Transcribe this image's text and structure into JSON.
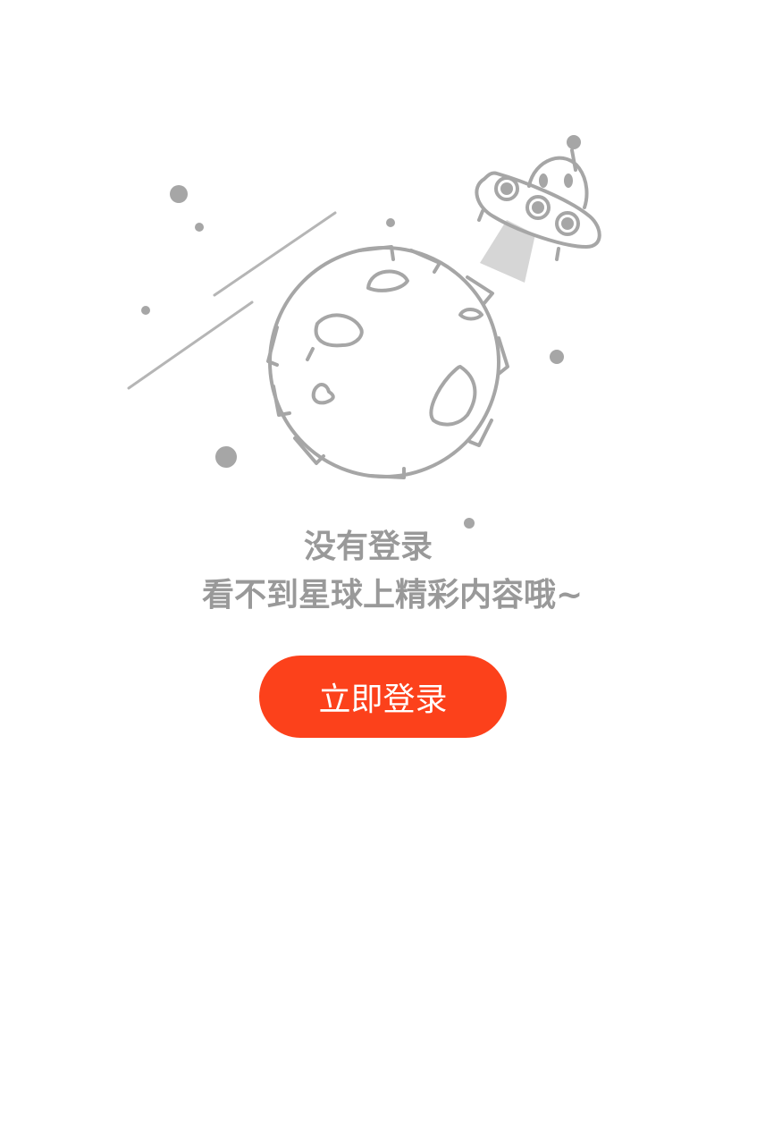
{
  "empty_state": {
    "title": "没有登录",
    "subtitle": "看不到星球上精彩内容哦~",
    "illustration_icon": "planet-ufo-illustration"
  },
  "login_button": {
    "label": "立即登录",
    "color": "#fc411b"
  },
  "colors": {
    "text_muted": "#999999",
    "illustration_stroke": "#a6a6a6",
    "background": "#ffffff"
  }
}
